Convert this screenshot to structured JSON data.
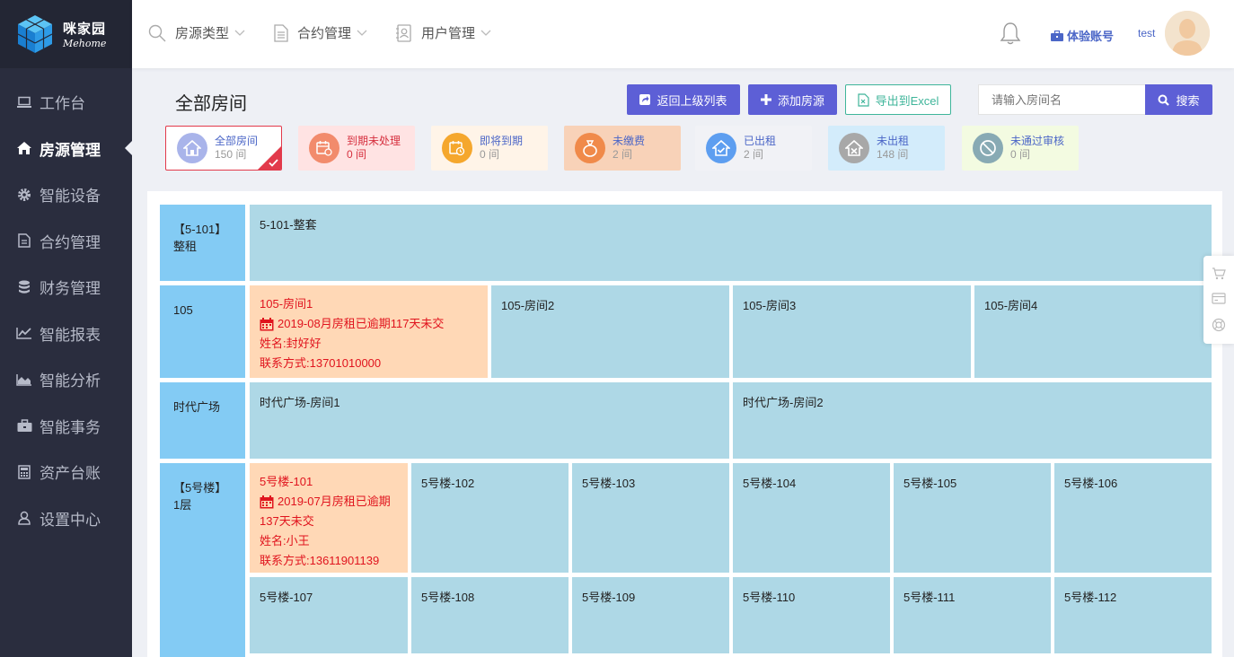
{
  "brand": {
    "name_cn": "咪家园",
    "name_en": "Mehome"
  },
  "sidebar": {
    "items": [
      {
        "label": "工作台",
        "icon": "laptop-icon"
      },
      {
        "label": "房源管理",
        "icon": "home-icon"
      },
      {
        "label": "智能设备",
        "icon": "gear-icon"
      },
      {
        "label": "合约管理",
        "icon": "document-icon"
      },
      {
        "label": "财务管理",
        "icon": "database-icon"
      },
      {
        "label": "智能报表",
        "icon": "line-chart-icon"
      },
      {
        "label": "智能分析",
        "icon": "area-chart-icon"
      },
      {
        "label": "智能事务",
        "icon": "briefcase-icon"
      },
      {
        "label": "资产台账",
        "icon": "calculator-icon"
      },
      {
        "label": "设置中心",
        "icon": "user-icon"
      }
    ],
    "active_index": 1
  },
  "header": {
    "menu": [
      {
        "label": "房源类型",
        "icon": "search-icon"
      },
      {
        "label": "合约管理",
        "icon": "document-icon"
      },
      {
        "label": "用户管理",
        "icon": "contact-icon"
      }
    ],
    "trial_label": "体验账号",
    "user_name": "test"
  },
  "toolbar": {
    "page_title": "全部房间",
    "back_label": "返回上级列表",
    "add_label": "添加房源",
    "export_label": "导出到Excel",
    "search_placeholder": "请输入房间名",
    "search_label": "搜索"
  },
  "filters": {
    "all": {
      "label": "全部房间",
      "count": "150 间",
      "color": "#a9b4ea"
    },
    "overdue": {
      "label": "到期未处理",
      "count": "0 间",
      "color": "#f28b6c"
    },
    "soon": {
      "label": "即将到期",
      "count": "0 间",
      "color": "#f5a72d"
    },
    "unpaid": {
      "label": "未缴费",
      "count": "2 间",
      "color": "#f08a4a"
    },
    "rented": {
      "label": "已出租",
      "count": "2 间",
      "color": "#5d9ef0"
    },
    "vacant": {
      "label": "未出租",
      "count": "148 间",
      "color": "#a8a8a8"
    },
    "unreviewed": {
      "label": "未通过审核",
      "count": "0 间",
      "color": "#88aab4"
    }
  },
  "buildings": {
    "b5101": {
      "label_1": "【5-101】",
      "label_2": "整租",
      "rooms": [
        "5-101-整套"
      ]
    },
    "b105": {
      "label_1": "105",
      "rooms": [
        "105-房间1",
        "105-房间2",
        "105-房间3",
        "105-房间4"
      ],
      "alert": {
        "overdue": "2019-08月房租已逾期117天未交",
        "name": "姓名:封好好",
        "phone": "联系方式:13701010000"
      }
    },
    "plaza": {
      "label_1": "时代广场",
      "rooms": [
        "时代广场-房间1",
        "时代广场-房间2"
      ]
    },
    "b5": {
      "label_1": "【5号楼】",
      "label_2": "1层",
      "rooms": [
        "5号楼-101",
        "5号楼-102",
        "5号楼-103",
        "5号楼-104",
        "5号楼-105",
        "5号楼-106",
        "5号楼-107",
        "5号楼-108",
        "5号楼-109",
        "5号楼-110",
        "5号楼-111",
        "5号楼-112"
      ],
      "alert": {
        "overdue_1": "2019-07月房租已逾期",
        "overdue_2": "137天未交",
        "name": "姓名:小王",
        "phone": "联系方式:13611901139"
      }
    }
  }
}
